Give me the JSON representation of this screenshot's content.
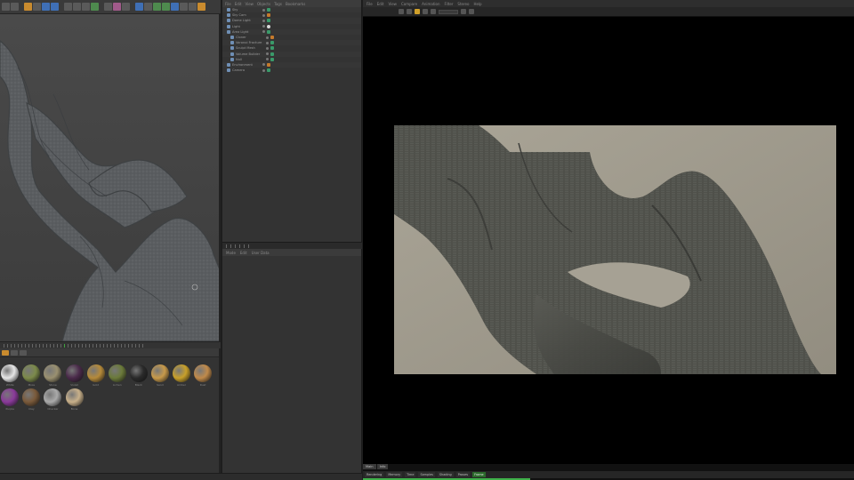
{
  "toolbar": {
    "buttons": [
      "undo-icon",
      "redo-icon",
      "select-icon",
      "move-icon",
      "scale-icon",
      "rotate-icon",
      "x-axis-icon",
      "y-axis-icon",
      "z-axis-icon",
      "world-icon",
      "render-region-icon",
      "render-view-icon",
      "render-settings-icon",
      "cube-icon",
      "pen-icon",
      "subdivision-icon",
      "array-icon",
      "deformer-icon",
      "floor-icon",
      "camera-icon",
      "light-icon"
    ]
  },
  "viewport": {
    "menu": [
      "View",
      "Cameras",
      "Display",
      "Options",
      "Filter",
      "Panel"
    ]
  },
  "object_manager": {
    "menu": [
      "File",
      "Edit",
      "View",
      "Objects",
      "Tags",
      "Bookmarks"
    ],
    "rows": [
      "Sky",
      "Sky Cam",
      "Dome Light",
      "Light",
      "Area Light",
      "Cloner",
      "Voronoi Fracture",
      "Sculpt Mesh",
      "Volume Builder",
      "Null",
      "Environment",
      "Camera"
    ]
  },
  "attribute_manager": {
    "menu": [
      "Mode",
      "Edit",
      "User Data"
    ]
  },
  "material_manager": {
    "materials": [
      {
        "name": "White",
        "color": "#e6e6e6"
      },
      {
        "name": "Moss",
        "color": "#7c8a4a"
      },
      {
        "name": "Stone",
        "color": "#9a9070"
      },
      {
        "name": "Violet",
        "color": "#4a2a4a"
      },
      {
        "name": "Gold",
        "color": "#b58a3a"
      },
      {
        "name": "Lichen",
        "color": "#6b7a3a"
      },
      {
        "name": "Black",
        "color": "#2a2a2a"
      },
      {
        "name": "Sand",
        "color": "#c89a4a"
      },
      {
        "name": "Amber",
        "color": "#c8a02a"
      },
      {
        "name": "Rust",
        "color": "#c08a4a"
      },
      {
        "name": "Purple",
        "color": "#8a3a9a"
      },
      {
        "name": "Clay",
        "color": "#7a5a3a"
      },
      {
        "name": "Checker",
        "color": "#aaaaaa"
      },
      {
        "name": "Bone",
        "color": "#c8b08a"
      }
    ]
  },
  "status": {
    "text": ""
  },
  "render_view": {
    "menu": [
      "File",
      "Edit",
      "View",
      "Compare",
      "Animation",
      "Filter",
      "Stereo",
      "Help"
    ],
    "tabs": [
      "Main",
      "Info"
    ],
    "status_cells": [
      "Rendering",
      "Memory",
      "Time",
      "Samples",
      "Shading",
      "Passes",
      "Frame"
    ],
    "progress": 0.34
  }
}
